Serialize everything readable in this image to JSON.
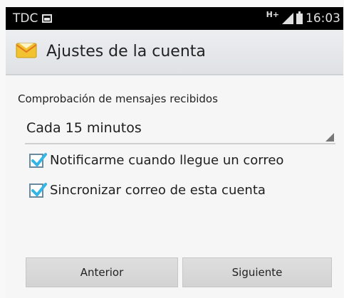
{
  "status_bar": {
    "carrier": "TDC",
    "network": "H+",
    "time": "16:03"
  },
  "action_bar": {
    "title": "Ajustes de la cuenta",
    "icon": "mail-envelope-icon"
  },
  "settings": {
    "check_frequency_label": "Comprobación de mensajes recibidos",
    "check_frequency_value": "Cada 15 minutos",
    "notify_label": "Notificarme cuando llegue un correo",
    "notify_checked": true,
    "sync_label": "Sincronizar correo de esta cuenta",
    "sync_checked": true
  },
  "buttons": {
    "previous": "Anterior",
    "next": "Siguiente"
  },
  "colors": {
    "check_accent": "#33b5e5",
    "status_bar": "#000000",
    "action_bar": "#e4e6e8"
  }
}
